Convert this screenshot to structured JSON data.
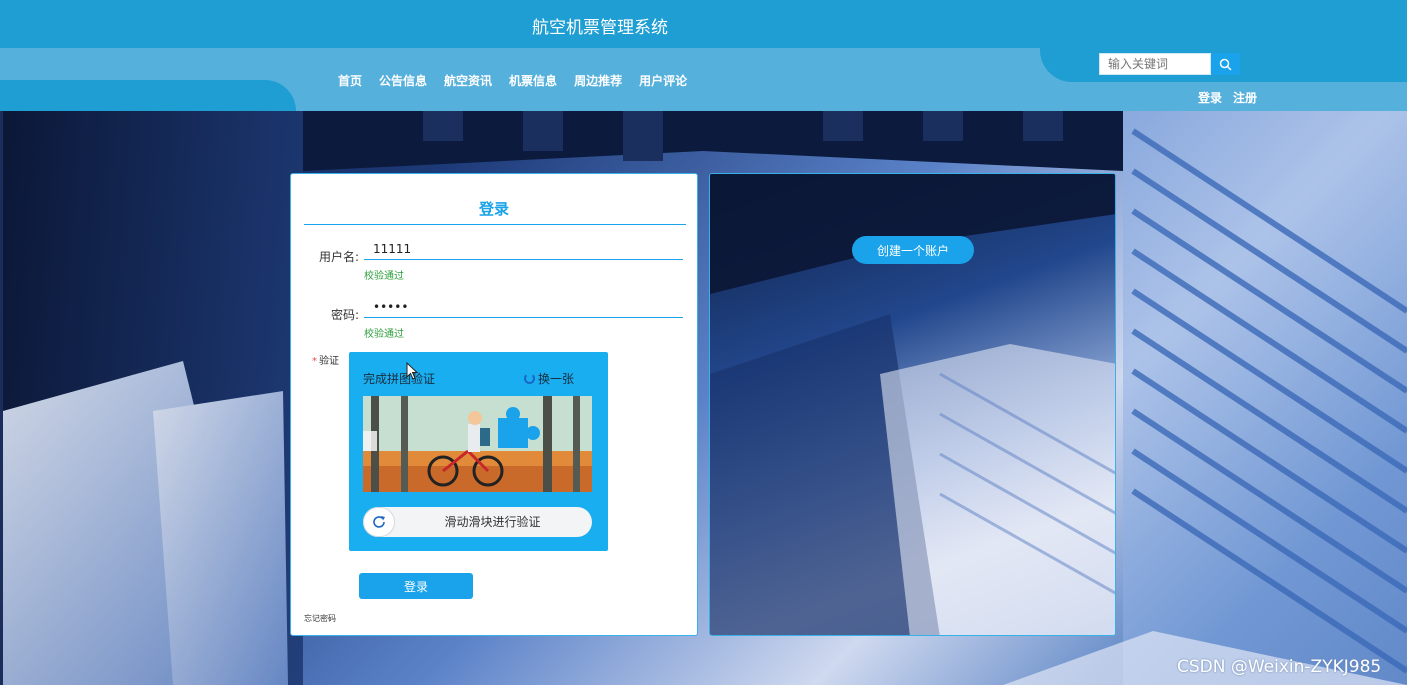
{
  "header": {
    "title": "航空机票管理系统",
    "nav": [
      "首页",
      "公告信息",
      "航空资讯",
      "机票信息",
      "周边推荐",
      "用户评论"
    ],
    "search_placeholder": "输入关键词",
    "login_link": "登录",
    "register_link": "注册"
  },
  "login": {
    "title": "登录",
    "username_label": "用户名:",
    "username_value": "11111",
    "username_status": "校验通过",
    "password_label": "密码:",
    "password_value": "•••••",
    "password_status": "校验通过",
    "captcha_label": "验证",
    "captcha_title": "完成拼图验证",
    "captcha_refresh": "换一张",
    "slider_text": "滑动滑块进行验证",
    "submit": "登录",
    "forgot": "忘记密码"
  },
  "register": {
    "create_account": "创建一个账户"
  },
  "watermark": "CSDN @Weixin-ZYKJ985",
  "colors": {
    "accent": "#1aa3ea",
    "header": "#1e9ed3",
    "nav_bar": "#56b0dc",
    "success": "#2e9d3c"
  },
  "icons": {
    "search": "search-icon",
    "refresh": "refresh-icon",
    "cursor": "mouse-pointer-icon"
  }
}
